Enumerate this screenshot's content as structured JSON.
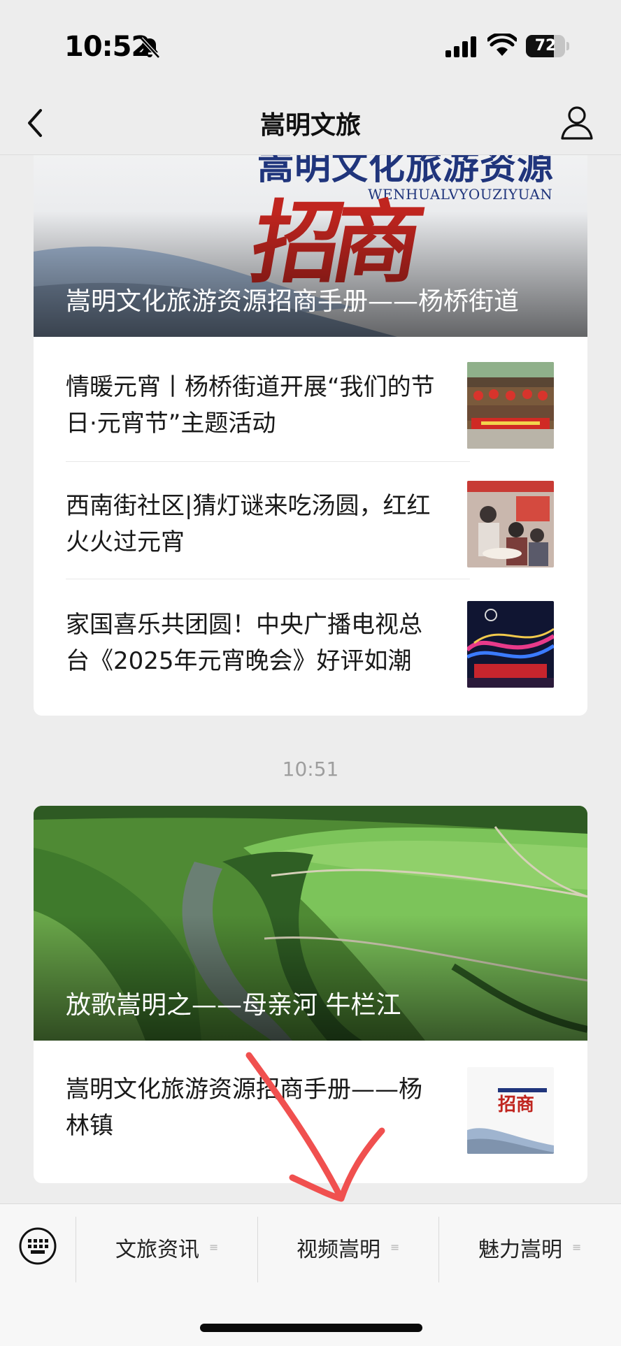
{
  "status_bar": {
    "time": "10:52",
    "battery_level": "72",
    "battery_fraction": 0.72,
    "icons": [
      "bell-slash-icon",
      "cellular-signal-icon",
      "wifi-icon",
      "battery-icon"
    ]
  },
  "nav": {
    "title": "嵩明文旅",
    "back_icon": "chevron-left-icon",
    "profile_icon": "person-icon"
  },
  "card1": {
    "cover_title": "嵩明文化旅游资源招商手册——杨桥街道",
    "cover_poster_title": "嵩明文化旅游资源",
    "cover_poster_subtitle": "WENHUALVYOUZIYUAN",
    "cover_poster_calligraphy": "招商",
    "articles": [
      {
        "title": "情暖元宵丨杨桥街道开展“我们的节日·元宵节”主题活动",
        "thumb": "lantern-festival-banner-photo"
      },
      {
        "title": "西南街社区|猜灯谜来吃汤圆，红红火火过元宵",
        "thumb": "riddle-and-tangyuan-photo"
      },
      {
        "title": "家国喜乐共团圆！中央广播电视总台《2025年元宵晚会》好评如潮",
        "thumb": "gala-stage-photo"
      }
    ]
  },
  "time_separator": "10:51",
  "card2": {
    "cover_title": "放歌嵩明之——母亲河 牛栏江",
    "cover_image": "aerial-river-farmland-photo",
    "articles": [
      {
        "title": "嵩明文化旅游资源招商手册——杨林镇",
        "thumb": "brochure-cover-thumbnail"
      }
    ]
  },
  "menu": {
    "keyboard_icon": "keyboard-icon",
    "items": [
      {
        "label": "文旅资讯",
        "icon": "menu-lines-icon"
      },
      {
        "label": "视频嵩明",
        "icon": "menu-lines-icon"
      },
      {
        "label": "魅力嵩明",
        "icon": "menu-lines-icon"
      }
    ]
  },
  "colors": {
    "background": "#ededed",
    "card": "#ffffff",
    "text": "#191919",
    "time_separator": "#9e9e9e",
    "annotation": "#f0504f",
    "poster_blue": "#20357c",
    "poster_red": "#c0251f"
  }
}
